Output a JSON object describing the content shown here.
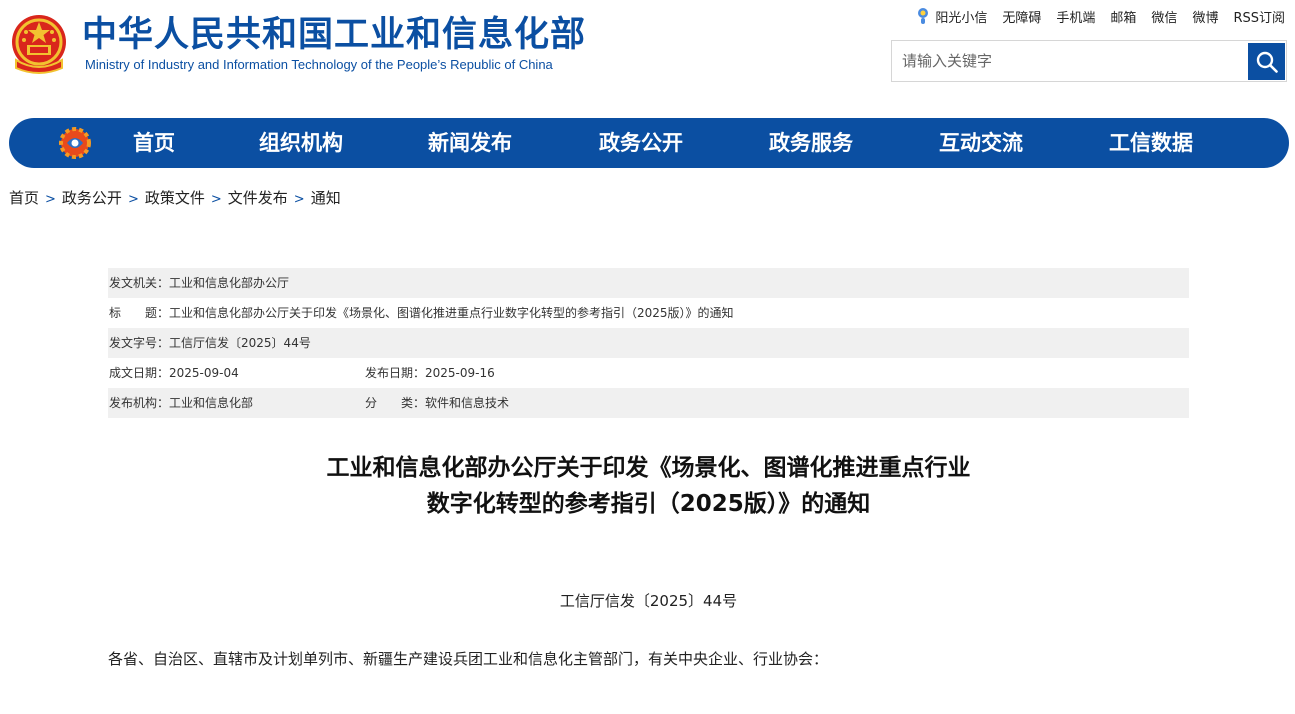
{
  "header": {
    "title_cn": "中华人民共和国工业和信息化部",
    "title_en": "Ministry of Industry and Information Technology of the People’s Republic of China",
    "top_links": [
      "阳光小信",
      "无障碍",
      "手机端",
      "邮箱",
      "微信",
      "微博",
      "RSS订阅"
    ],
    "search_placeholder": "请输入关键字"
  },
  "nav": {
    "items": [
      "首页",
      "组织机构",
      "新闻发布",
      "政务公开",
      "政务服务",
      "互动交流",
      "工信数据"
    ]
  },
  "breadcrumb": [
    "首页",
    "政务公开",
    "政策文件",
    "文件发布",
    "通知"
  ],
  "info": {
    "issuer_label": "发文机关：",
    "issuer": "工业和信息化部办公厅",
    "title_label": "标　　题：",
    "title": "工业和信息化部办公厅关于印发《场景化、图谱化推进重点行业数字化转型的参考指引（2025版）》的通知",
    "doc_no_label": "发文字号：",
    "doc_no": "工信厅信发〔2025〕44号",
    "written_label": "成文日期：",
    "written": "2025-09-04",
    "published_label": "发布日期：",
    "published": "2025-09-16",
    "org_label": "发布机构：",
    "org": "工业和信息化部",
    "category_label": "分　　类：",
    "category": "软件和信息技术"
  },
  "article": {
    "title_line1": "工业和信息化部办公厅关于印发《场景化、图谱化推进重点行业",
    "title_line2": "数字化转型的参考指引（2025版）》的通知",
    "doc_number": "工信厅信发〔2025〕44号",
    "salutation": "各省、自治区、直辖市及计划单列市、新疆生产建设兵团工业和信息化主管部门，有关中央企业、行业协会："
  },
  "colors": {
    "brand_blue": "#0b4fa2",
    "row_shade": "#f0f0f0"
  }
}
